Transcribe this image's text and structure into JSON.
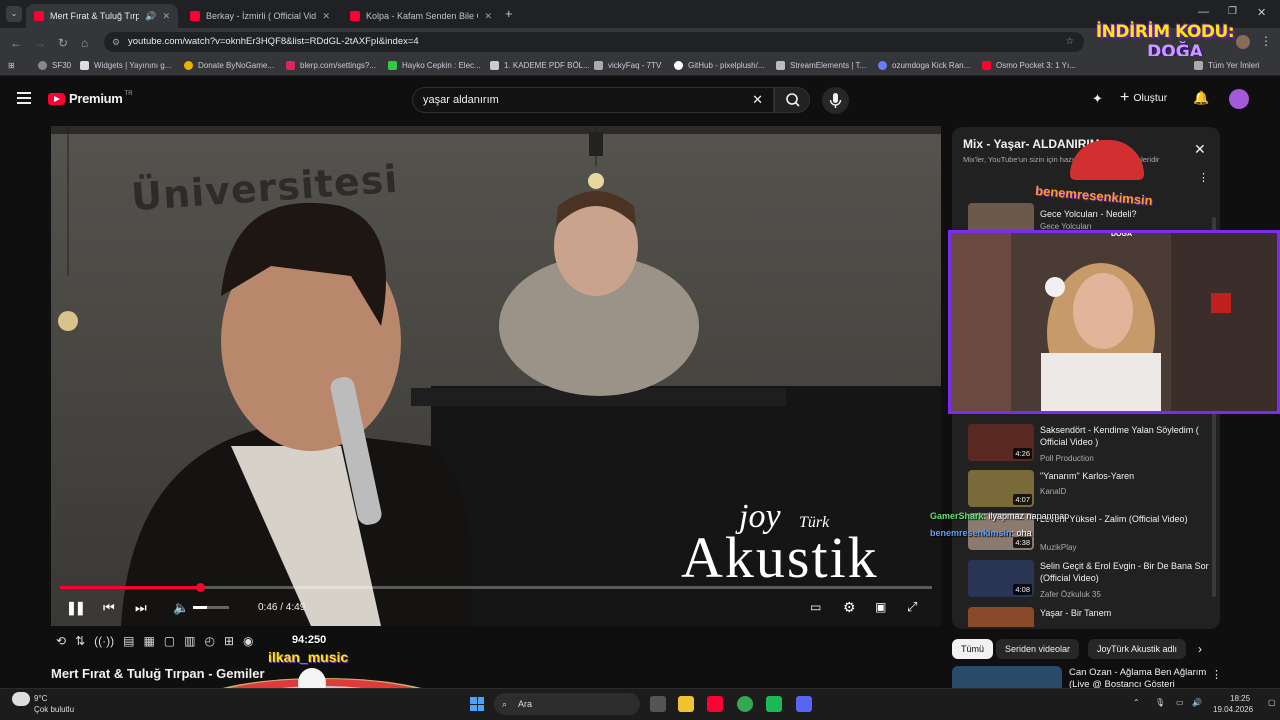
{
  "browser": {
    "tabs": [
      {
        "title": "Mert Fırat & Tuluğ Tırpan",
        "active": true
      },
      {
        "title": "Berkay - İzmirli ( Official Video )",
        "active": false
      },
      {
        "title": "Kolpa - Kafam Senden Bile Güzel",
        "active": false
      }
    ],
    "url": "youtube.com/watch?v=oknhEr3HQF8&list=RDdGL-2tAXFpI&index=4",
    "bookmarks": [
      "SF30",
      "Widgets | Yayınını g...",
      "Donate ByNoGame...",
      "blerp.com/settings?...",
      "Hayko Cepkin : Elec...",
      "1. KADEME PDF BÖL...",
      "vickyFaq - 7TV",
      "GitHub - pixelplush/...",
      "StreamElements | T...",
      "ozumdoga Kick Ran...",
      "Osmo Pocket 3: 1 Yı..."
    ],
    "all_bookmarks": "Tüm Yer İmleri"
  },
  "overlay": {
    "promo_line1": "İNDİRİM KODU:",
    "promo_line2": "DOĞA",
    "parachute_user": "benemresenkimsin",
    "cam_label": "DOĞA",
    "chat": [
      {
        "user": "GamerShark",
        "text": "ilyapmaz napanmap"
      },
      {
        "user": "benemresenkimsin",
        "text": "oha"
      }
    ],
    "music_user": "ilkan_music",
    "timer": "94:250"
  },
  "youtube": {
    "logo": "Premium",
    "logo_region": "TR",
    "search_query": "yaşar aldanırım",
    "create_label": "Oluştur",
    "video": {
      "brand_top": "joy",
      "brand_mid": "Türk",
      "brand_main": "Akustik",
      "wall_text": "Üniversitesi",
      "time": "0:46 / 4:49",
      "progress": 0.16,
      "title": "Mert Fırat & Tuluğ Tırpan - Gemiler"
    },
    "playlist": {
      "title": "Mix - Yaşar- ALDANIRIM",
      "subtitle": "Mix'ler, YouTube'un sizin için hazırladığı oynatma listeleridir",
      "items": [
        {
          "title": "Gece Yolcuları - Nedeli?",
          "channel": "Gece Yolcuları",
          "duration": ""
        },
        {
          "title": "Saksendört - Kendime Yalan Söyledim ( Official Video )",
          "channel": "Poll Production",
          "duration": "4:26"
        },
        {
          "title": "\"Yanarım\" Karlos-Yaren",
          "channel": "KanalD",
          "duration": "4:07"
        },
        {
          "title": "Levent Yüksel - Zalim (Official Video)",
          "channel": "MuzikPlay",
          "duration": "4:38"
        },
        {
          "title": "Selin Geçit & Erol Evgin - Bir De Bana Sor (Official Video)",
          "channel": "Zafer Özkuluk 35",
          "duration": "4:08"
        },
        {
          "title": "Yaşar - Bir Tanem",
          "channel": "",
          "duration": ""
        }
      ]
    },
    "chips": [
      "Tümü",
      "Seriden videolar",
      "JoyTürk Akustik adlı"
    ],
    "rec_title": "Can Ozan - Ağlama Ben Ağlarım (Live @ Bostancı Gösteri"
  },
  "taskbar": {
    "weather_temp": "9°C",
    "weather_desc": "Çok bulutlu",
    "search": "Ara",
    "time": "18:25",
    "date": "19.04.2026"
  },
  "colors": {
    "accent_red": "#ff0033",
    "cam_border": "#7b2cf0",
    "promo_yellow": "#ffe600"
  }
}
